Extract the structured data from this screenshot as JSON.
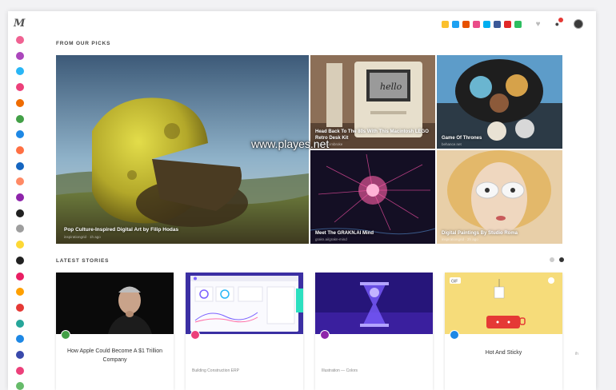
{
  "brand": {
    "logo": "M"
  },
  "sidebar": {
    "items": [
      {
        "icon": "category-icon-1",
        "color": "#f06292"
      },
      {
        "icon": "category-icon-2",
        "color": "#ab47bc"
      },
      {
        "icon": "category-icon-3",
        "color": "#29b6f6"
      },
      {
        "icon": "category-icon-4",
        "color": "#ec407a"
      },
      {
        "icon": "category-icon-5",
        "color": "#ef6c00"
      },
      {
        "icon": "category-icon-6",
        "color": "#43a047"
      },
      {
        "icon": "category-icon-7",
        "color": "#1e88e5"
      },
      {
        "icon": "category-icon-8",
        "color": "#ff7043"
      },
      {
        "icon": "category-icon-9",
        "color": "#1565c0"
      },
      {
        "icon": "category-icon-10",
        "color": "#ff8a65"
      },
      {
        "icon": "category-icon-11",
        "color": "#8e24aa"
      },
      {
        "icon": "category-icon-12",
        "color": "#212121"
      },
      {
        "icon": "category-icon-13",
        "color": "#9e9e9e"
      },
      {
        "icon": "category-icon-14",
        "color": "#fdd835"
      },
      {
        "icon": "category-icon-15",
        "color": "#212121"
      },
      {
        "icon": "category-icon-16",
        "color": "#e91e63"
      },
      {
        "icon": "category-icon-17",
        "color": "#ffa000"
      },
      {
        "icon": "category-icon-18",
        "color": "#e53935"
      },
      {
        "icon": "category-icon-19",
        "color": "#26a69a"
      },
      {
        "icon": "category-icon-20",
        "color": "#1e88e5"
      },
      {
        "icon": "category-icon-21",
        "color": "#3949ab"
      },
      {
        "icon": "category-icon-22",
        "color": "#ec407a"
      },
      {
        "icon": "category-icon-23",
        "color": "#66bb6a"
      }
    ]
  },
  "header": {
    "social_icons": [
      {
        "icon": "feed-icon",
        "color": "#fbc02d"
      },
      {
        "icon": "twitter-icon",
        "color": "#1da1f2"
      },
      {
        "icon": "producthunt-icon",
        "color": "#e65100"
      },
      {
        "icon": "dribbble-icon",
        "color": "#ea4c89"
      },
      {
        "icon": "skype-icon",
        "color": "#00aff0"
      },
      {
        "icon": "facebook-icon",
        "color": "#3b5998"
      },
      {
        "icon": "flipboard-icon",
        "color": "#e12828"
      },
      {
        "icon": "evernote-icon",
        "color": "#2dbe60"
      }
    ]
  },
  "picks": {
    "title": "FROM OUR PICKS",
    "items": [
      {
        "title": "Pop Culture-Inspired Digital Art by Filip Hodas",
        "meta": "inspirationgrid · 1h ago"
      },
      {
        "title": "Head Back To The 80s With This Macintosh LEGO Retro Desk Kit",
        "meta": "thisiswhyimbroke"
      },
      {
        "title": "Game Of Thrones",
        "meta": "behance.net"
      },
      {
        "title": "Meet The GRAKN.AI Mind",
        "meta": "grakn.ai/grakn-mind"
      },
      {
        "title": "Digital Paintings By Studio Roma",
        "meta": "inspirationgrid · 2h ago"
      }
    ]
  },
  "watermark": "www.playes.net",
  "latest": {
    "title": "LATEST STORIES",
    "cards": [
      {
        "title": "How Apple Could Become A $1 Trillion Company",
        "meta": "",
        "badge_color": "#43a047"
      },
      {
        "title": "",
        "meta": "Building Construction ERP",
        "badge_color": "#ec407a"
      },
      {
        "title": "",
        "meta": "Illustration — Colors",
        "badge_color": "#8e24aa"
      },
      {
        "title": "Hot And Sticky",
        "meta": "",
        "badge_color": "#1e88e5"
      }
    ]
  },
  "side_label": "ih"
}
